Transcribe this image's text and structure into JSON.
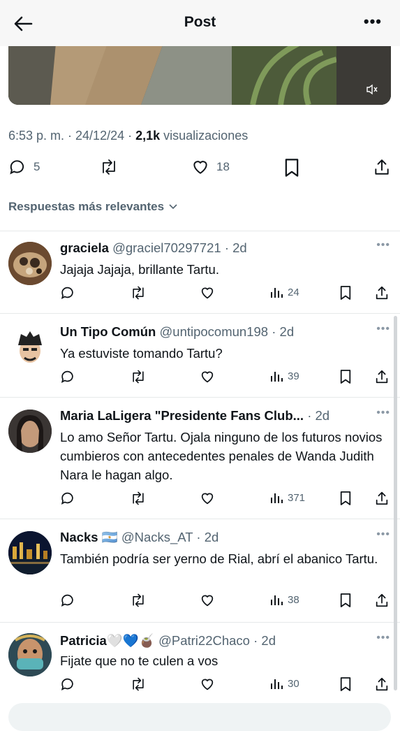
{
  "header": {
    "title": "Post"
  },
  "tweet": {
    "time": "6:53 p. m. · 24/12/24 · ",
    "views_count": "2,1k",
    "views_label": " visualizaciones",
    "replies": "5",
    "likes": "18"
  },
  "sort_label": "Respuestas más relevantes",
  "replies": [
    {
      "name": "graciela",
      "handle": "@graciel70297721",
      "time": "· 2d",
      "text": "Jajaja Jajaja, brillante  Tartu.",
      "views": "24"
    },
    {
      "name": "Un Tipo Común",
      "handle": "@untipocomun198",
      "time": "· 2d",
      "text": "Ya estuviste tomando Tartu?",
      "views": "39"
    },
    {
      "name": "Maria LaLigera \"Presidente Fans Club...",
      "handle": "",
      "time": "· 2d",
      "text": "Lo amo Señor Tartu. Ojala ninguno de los futuros novios cumbieros con antecedentes penales de Wanda Judith Nara le hagan algo.",
      "views": "371"
    },
    {
      "name": "Nacks 🇦🇷",
      "handle": "@Nacks_AT",
      "time": "· 2d",
      "text": "También podría ser yerno de Rial, abrí el abanico Tartu.",
      "views": "38"
    },
    {
      "name": "Patricia🤍💙🧉",
      "handle": "@Patri22Chaco",
      "time": "· 2d",
      "text": "Fijate que no te culen a vos",
      "views": "30"
    }
  ],
  "colors": {
    "text": "#0f1419",
    "secondary": "#536471",
    "divider": "#e6e9ea"
  }
}
